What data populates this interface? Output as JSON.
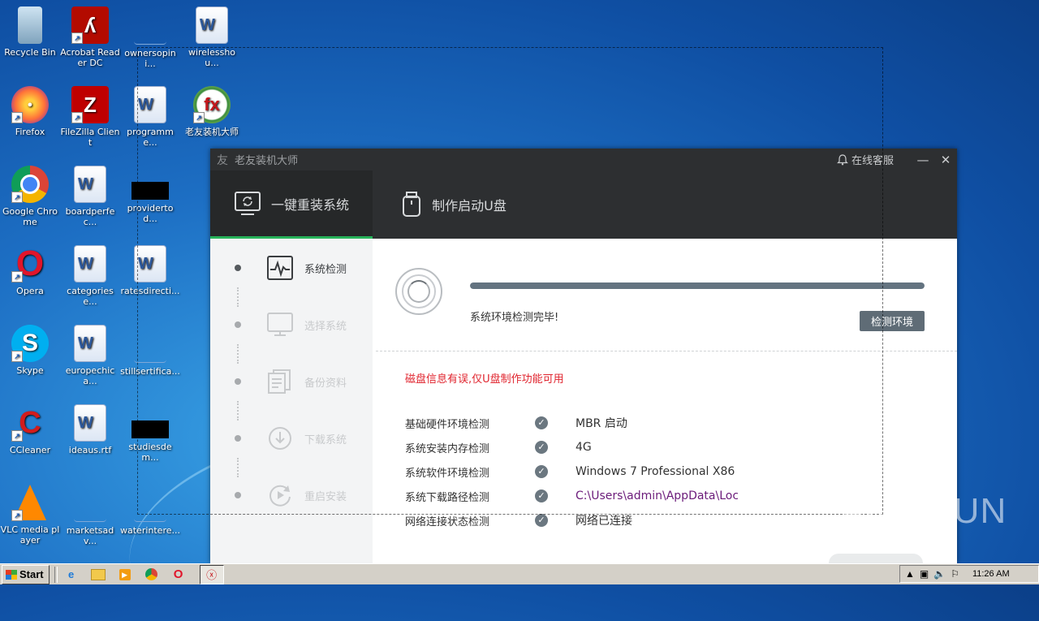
{
  "desktop": {
    "icons": [
      {
        "label": "Recycle Bin"
      },
      {
        "label": "Acrobat Reader DC"
      },
      {
        "label": "ownersopini..."
      },
      {
        "label": "wirelesshou..."
      },
      {
        "label": "Firefox"
      },
      {
        "label": "FileZilla Client"
      },
      {
        "label": "programme..."
      },
      {
        "label": "老友装机大师"
      },
      {
        "label": "Google Chrome"
      },
      {
        "label": "boardperfec..."
      },
      {
        "label": "providertod..."
      },
      {
        "label": "Opera"
      },
      {
        "label": "categoriese..."
      },
      {
        "label": "ratesdirecti..."
      },
      {
        "label": "Skype"
      },
      {
        "label": "europechica..."
      },
      {
        "label": "stillsertifica..."
      },
      {
        "label": "CCleaner"
      },
      {
        "label": "ideaus.rtf"
      },
      {
        "label": "studiesdem..."
      },
      {
        "label": "VLC media player"
      },
      {
        "label": "marketsadv..."
      },
      {
        "label": "waterintere..."
      }
    ],
    "watermark": "ANY RUN"
  },
  "app": {
    "title": "老友装机大师",
    "service": "在线客服",
    "minimize": "—",
    "close": "✕",
    "tabs": [
      {
        "label": "一键重装系统",
        "active": true
      },
      {
        "label": "制作启动U盘",
        "active": false
      }
    ],
    "steps": [
      {
        "label": "系统检测",
        "icon": "pulse-monitor-icon",
        "active": true
      },
      {
        "label": "选择系统",
        "icon": "monitor-icon",
        "active": false
      },
      {
        "label": "备份资料",
        "icon": "documents-icon",
        "active": false
      },
      {
        "label": "下载系统",
        "icon": "download-icon",
        "active": false
      },
      {
        "label": "重启安装",
        "icon": "restart-icon",
        "active": false
      }
    ],
    "progress": 1.0,
    "status_text": "系统环境检测完毕!",
    "detect_button": "检测环境",
    "warning": "磁盘信息有误,仅U盘制作功能可用",
    "checks": [
      {
        "label": "基础硬件环境检测",
        "value": "MBR 启动"
      },
      {
        "label": "系统安装内存检测",
        "value": "4G"
      },
      {
        "label": "系统软件环境检测",
        "value": "Windows 7 Professional X86"
      },
      {
        "label": "系统下载路径检测",
        "value": "C:\\Users\\admin\\AppData\\Loca"
      },
      {
        "label": "网络连接状态检测",
        "value": "网络已连接"
      }
    ],
    "accent_color": "#27b35a",
    "warning_color": "#e0242e"
  },
  "taskbar": {
    "start_label": "Start",
    "clock": "11:26 AM"
  }
}
